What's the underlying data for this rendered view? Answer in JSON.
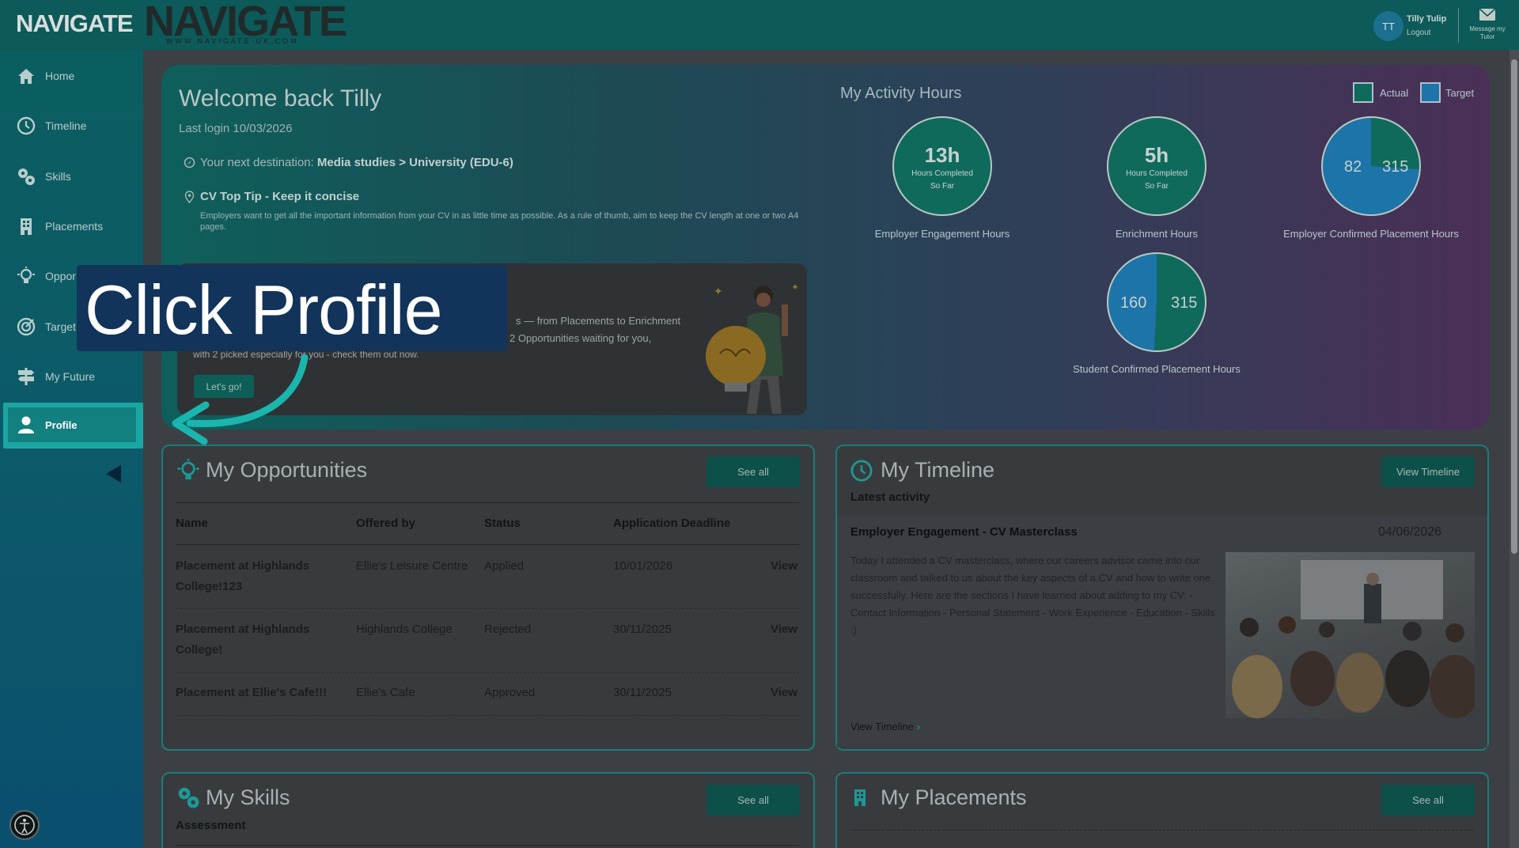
{
  "app": {
    "logo_small": "NAVIGATE",
    "logo_big": "NAVIGATE",
    "logo_big_sub": "WWW.NAVIGATE-UK.COM"
  },
  "user": {
    "initials": "TT",
    "name": "Tilly Tulip",
    "logout": "Logout",
    "message_label": "Message my Tutor"
  },
  "sidebar": {
    "items": [
      {
        "label": "Home",
        "icon": "home-icon"
      },
      {
        "label": "Timeline",
        "icon": "clock-icon"
      },
      {
        "label": "Skills",
        "icon": "gears-icon"
      },
      {
        "label": "Placements",
        "icon": "building-icon"
      },
      {
        "label": "Oppor",
        "icon": "lightbulb-icon"
      },
      {
        "label": "Target",
        "icon": "target-icon"
      },
      {
        "label": "My Future",
        "icon": "signpost-icon"
      },
      {
        "label": "Profile",
        "icon": "user-icon"
      }
    ]
  },
  "hero": {
    "title": "Welcome back Tilly",
    "last_login": "Last login 10/03/2026",
    "dest_prefix": "Your next destination: ",
    "dest_value": "Media studies > University (EDU-6)",
    "tip_title": "CV Top Tip - Keep it concise",
    "tip_text": "Employers want to get all the important information from your CV in as little time as possible. As a rule of thumb, aim to keep the CV length at one or two A4 pages.",
    "promo_line1": "s — from Placements to Enrichment",
    "promo_line2": "2 Opportunities waiting for you,",
    "promo_line3": "with 2 picked especially for you - check them out now.",
    "promo_button": "Let's go!"
  },
  "activity": {
    "title": "My Activity Hours",
    "legend_actual": "Actual",
    "legend_target": "Target",
    "actual_color": "#0f6a5c",
    "target_color": "#1d74a8",
    "employer_engagement": {
      "value": "13h",
      "sub1": "Hours Completed",
      "sub2": "So Far",
      "label": "Employer Engagement Hours"
    },
    "enrichment": {
      "value": "5h",
      "sub1": "Hours Completed",
      "sub2": "So Far",
      "label": "Enrichment Hours"
    },
    "employer_confirmed": {
      "actual": "82",
      "target": "315",
      "label": "Employer Confirmed Placement Hours"
    },
    "student_confirmed": {
      "actual": "160",
      "target": "315",
      "label": "Student Confirmed Placement Hours"
    }
  },
  "callout": {
    "text": "Click Profile"
  },
  "opportunities": {
    "title": "My Opportunities",
    "see_all": "See all",
    "headers": [
      "Name",
      "Offered by",
      "Status",
      "Application Deadline"
    ],
    "view_label": "View",
    "rows": [
      {
        "name": "Placement at Highlands College!123",
        "offered_by": "Ellie's Leisure Centre",
        "status": "Applied",
        "deadline": "10/01/2026"
      },
      {
        "name": "Placement at Highlands College!",
        "offered_by": "Highlands College",
        "status": "Rejected",
        "deadline": "30/11/2025"
      },
      {
        "name": "Placement at Ellie's Cafe!!!",
        "offered_by": "Ellie's Cafe",
        "status": "Approved",
        "deadline": "30/11/2025"
      }
    ]
  },
  "timeline": {
    "title": "My Timeline",
    "view_button": "View Timeline",
    "subtitle": "Latest activity",
    "entry_title": "Employer Engagement - CV Masterclass",
    "entry_date": "04/06/2026",
    "entry_text": "Today I attended a CV masterclass, where our careers advisor came into our classroom and talked to us about the key aspects of a CV and how to write one successfully. Here are the sections I have learned about adding to my CV: - Contact Information - Personal Statement - Work Experience - Education - Skills :)",
    "link": "View Timeline"
  },
  "skills": {
    "title": "My Skills",
    "see_all": "See all",
    "subtitle": "Assessment"
  },
  "placements": {
    "title": "My Placements",
    "see_all": "See all"
  }
}
